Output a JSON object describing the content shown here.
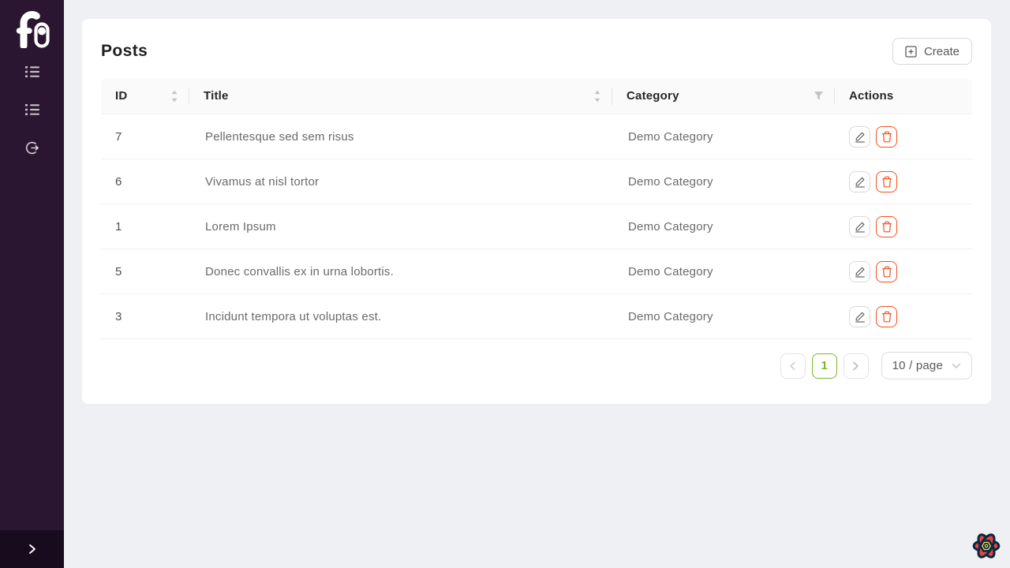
{
  "colors": {
    "sidebar_bg": "#2b1631",
    "sidebar_trigger_bg": "#170b1d",
    "page_bg": "#eef0f4",
    "accent_green": "#76b82a",
    "danger_orange": "#f4511e",
    "header_row_bg": "#fafafa"
  },
  "sidebar": {
    "logo_icon": "f-toggle-logo",
    "items": [
      {
        "icon": "list-icon"
      },
      {
        "icon": "list-icon"
      },
      {
        "icon": "logout-icon"
      }
    ],
    "collapse_icon": "chevron-right-icon"
  },
  "page": {
    "title": "Posts",
    "create_button_label": "Create",
    "create_button_icon": "plus-square-icon"
  },
  "table": {
    "columns": [
      {
        "label": "ID",
        "icon": "sort-carets-icon"
      },
      {
        "label": "Title",
        "icon": "sort-carets-icon"
      },
      {
        "label": "Category",
        "icon": "filter-funnel-icon"
      },
      {
        "label": "Actions",
        "icon": ""
      }
    ],
    "row_action_icons": [
      "edit-pencil-icon",
      "delete-trash-icon"
    ],
    "rows": [
      {
        "id": "7",
        "title": "Pellentesque sed sem risus",
        "category": "Demo Category"
      },
      {
        "id": "6",
        "title": "Vivamus at nisl tortor",
        "category": "Demo Category"
      },
      {
        "id": "1",
        "title": "Lorem Ipsum",
        "category": "Demo Category"
      },
      {
        "id": "5",
        "title": "Donec convallis ex in urna lobortis.",
        "category": "Demo Category"
      },
      {
        "id": "3",
        "title": "Incidunt tempora ut voluptas est.",
        "category": "Demo Category"
      }
    ]
  },
  "pagination": {
    "prev_icon": "chevron-left-icon",
    "current_page": "1",
    "next_icon": "chevron-right-icon",
    "page_size_label": "10 / page",
    "page_size_icon": "chevron-down-icon"
  },
  "devtools": {
    "icon": "react-query-flower-icon"
  }
}
